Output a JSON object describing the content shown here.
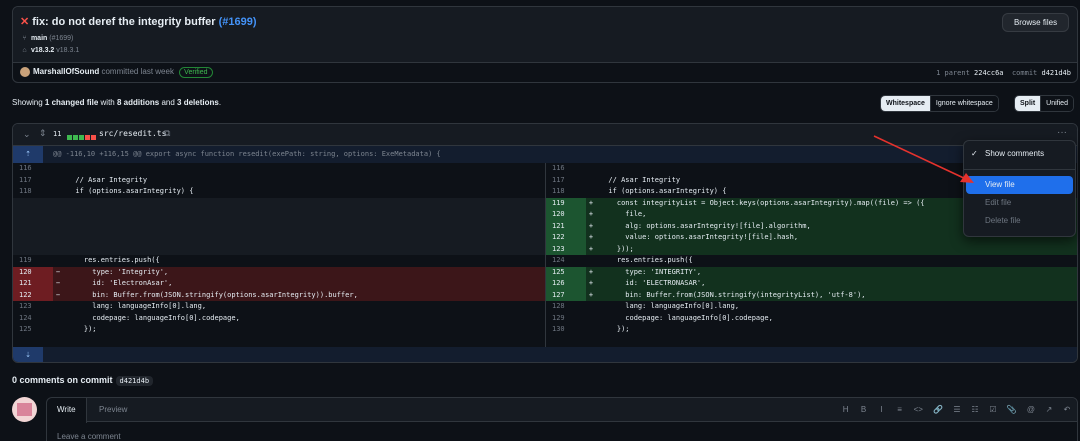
{
  "commit": {
    "title": "fix: do not deref the integrity buffer",
    "pr": "(#1699)",
    "branch": "main",
    "branch_pr": "(#1699)",
    "tag_main": "v18.3.2",
    "tag_other": "v18.3.1",
    "browse_label": "Browse files",
    "author": "MarshallOfSound",
    "committed_text": "committed last week",
    "verified": "Verified",
    "parent_label": "1 parent",
    "parent_sha": "224cc6a",
    "commit_label": "commit",
    "commit_sha": "d421d4b"
  },
  "stats": {
    "prefix": "Showing",
    "changed": "1 changed file",
    "with": "with",
    "additions": "8 additions",
    "and": "and",
    "deletions": "3 deletions",
    "period": "."
  },
  "view_toggle": {
    "whitespace": "Whitespace",
    "ignore_whitespace": "Ignore whitespace",
    "split": "Split",
    "unified": "Unified"
  },
  "file": {
    "count": "11",
    "name": "src/resedit.ts",
    "hunk": "@@ -116,10 +116,15 @@ export async function resedit(exePath: string, options: ExeMetadata) {",
    "colors": {
      "add": "#3fb950",
      "del": "#f85149",
      "neutral": "#30363d"
    }
  },
  "left_rows": [
    {
      "n": "116",
      "t": "ctx",
      "s": "",
      "c": ""
    },
    {
      "n": "117",
      "t": "ctx",
      "s": "",
      "c": "  // Asar Integrity"
    },
    {
      "n": "118",
      "t": "ctx",
      "s": "",
      "c": "  if (options.asarIntegrity) {"
    },
    {
      "n": "",
      "t": "empty",
      "s": "",
      "c": ""
    },
    {
      "n": "",
      "t": "empty",
      "s": "",
      "c": ""
    },
    {
      "n": "",
      "t": "empty",
      "s": "",
      "c": ""
    },
    {
      "n": "",
      "t": "empty",
      "s": "",
      "c": ""
    },
    {
      "n": "",
      "t": "empty",
      "s": "",
      "c": ""
    },
    {
      "n": "119",
      "t": "ctx",
      "s": "",
      "c": "    res.entries.push({"
    },
    {
      "n": "120",
      "t": "del",
      "s": "−",
      "c": "      type: 'Integrity',"
    },
    {
      "n": "121",
      "t": "del",
      "s": "−",
      "c": "      id: 'ElectronAsar',"
    },
    {
      "n": "122",
      "t": "del",
      "s": "−",
      "c": "      bin: Buffer.from(JSON.stringify(options.asarIntegrity)).buffer,"
    },
    {
      "n": "123",
      "t": "ctx",
      "s": "",
      "c": "      lang: languageInfo[0].lang,"
    },
    {
      "n": "124",
      "t": "ctx",
      "s": "",
      "c": "      codepage: languageInfo[0].codepage,"
    },
    {
      "n": "125",
      "t": "ctx",
      "s": "",
      "c": "    });"
    }
  ],
  "right_rows": [
    {
      "n": "116",
      "t": "ctx",
      "s": "",
      "c": ""
    },
    {
      "n": "117",
      "t": "ctx",
      "s": "",
      "c": "  // Asar Integrity"
    },
    {
      "n": "118",
      "t": "ctx",
      "s": "",
      "c": "  if (options.asarIntegrity) {"
    },
    {
      "n": "119",
      "t": "add",
      "s": "+",
      "c": "    const integrityList = Object.keys(options.asarIntegrity).map((file) => ({"
    },
    {
      "n": "120",
      "t": "add",
      "s": "+",
      "c": "      file,"
    },
    {
      "n": "121",
      "t": "add",
      "s": "+",
      "c": "      alg: options.asarIntegrity![file].algorithm,"
    },
    {
      "n": "122",
      "t": "add",
      "s": "+",
      "c": "      value: options.asarIntegrity![file].hash,"
    },
    {
      "n": "123",
      "t": "add",
      "s": "+",
      "c": "    }));"
    },
    {
      "n": "124",
      "t": "ctx",
      "s": "",
      "c": "    res.entries.push({"
    },
    {
      "n": "125",
      "t": "add",
      "s": "+",
      "c": "      type: 'INTEGRITY',"
    },
    {
      "n": "126",
      "t": "add",
      "s": "+",
      "c": "      id: 'ELECTRONASAR',"
    },
    {
      "n": "127",
      "t": "add",
      "s": "+",
      "c": "      bin: Buffer.from(JSON.stringify(integrityList), 'utf-8'),"
    },
    {
      "n": "128",
      "t": "ctx",
      "s": "",
      "c": "      lang: languageInfo[0].lang,"
    },
    {
      "n": "129",
      "t": "ctx",
      "s": "",
      "c": "      codepage: languageInfo[0].codepage,"
    },
    {
      "n": "130",
      "t": "ctx",
      "s": "",
      "c": "    });"
    }
  ],
  "menu": {
    "show_comments": "Show comments",
    "view_file": "View file",
    "edit_file": "Edit file",
    "delete_file": "Delete file"
  },
  "comments": {
    "title": "0 comments on commit",
    "sha": "d421d4b",
    "tab_write": "Write",
    "tab_preview": "Preview",
    "placeholder": "Leave a comment",
    "toolbar": [
      "H",
      "B",
      "I",
      "≡",
      "<>",
      "🔗",
      "☰",
      "☷",
      "☑",
      "📎",
      "@",
      "↗",
      "↶"
    ]
  }
}
